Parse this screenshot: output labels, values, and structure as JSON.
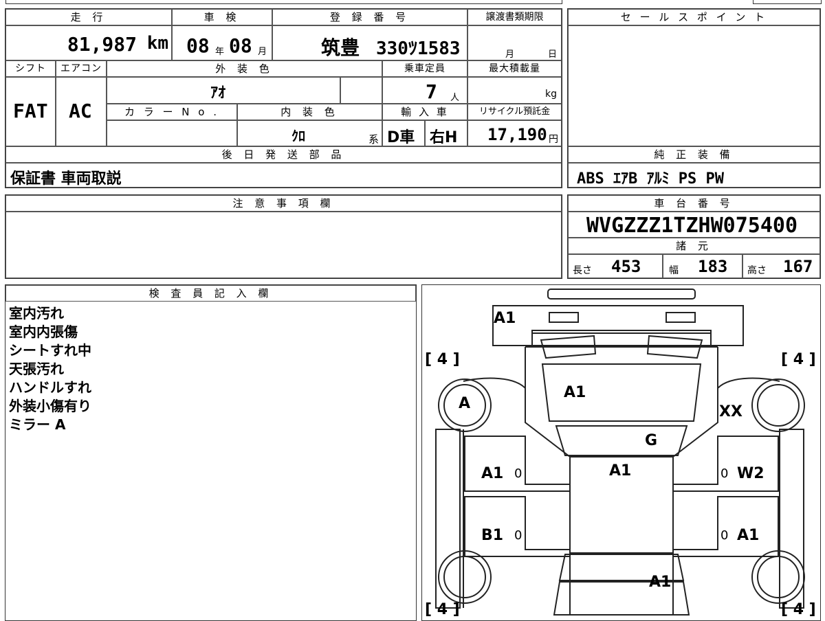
{
  "labels": {
    "mileage": "走 行",
    "inspection": "車 検",
    "registration": "登 録 番 号",
    "transfer_deadline": "譲渡書類期限",
    "sale_points": "セ ー ル ス ポ イ ン ト",
    "shift": "シフト",
    "aircon": "エアコン",
    "exterior_color": "外 装 色",
    "capacity": "乗車定員",
    "max_load": "最大積載量",
    "color_no": "カ ラ ー N o .",
    "interior_color": "内 装 色",
    "import": "輸 入 車",
    "recycle_fee": "リサイクル預託金",
    "later_parts": "後 日 発 送 部 品",
    "standard_equipment": "純 正 装 備",
    "notes": "注 意 事 項 欄",
    "chassis_number": "車 台 番 号",
    "specs": "諸 元",
    "inspector_notes": "検 査 員 記 入 欄"
  },
  "vehicle": {
    "mileage_value": "81,987",
    "mileage_unit": "km",
    "inspection_year": "08",
    "year_unit": "年",
    "inspection_month": "08",
    "month_unit": "月",
    "plate_region": "筑豊",
    "plate_number": "330ﾂ1583",
    "deadline_month": "月",
    "deadline_day": "日",
    "shift": "FAT",
    "aircon": "AC",
    "exterior_color": "ｱｵ",
    "capacity_value": "7",
    "capacity_unit": "人",
    "max_load_unit": "kg",
    "interior_color": "ｸﾛ",
    "interior_suffix": "系",
    "import_type": "D車",
    "handle": "右H",
    "recycle_value": "17,190",
    "recycle_unit": "円",
    "later_parts": "保証書 車両取説",
    "standard_equipment": "ABS ｴｱB ｱﾙﾐ PS PW",
    "chassis_number": "WVGZZZ1TZHW075400",
    "length_label": "長さ",
    "length_value": "453",
    "width_label": "幅",
    "width_value": "183",
    "height_label": "高さ",
    "height_value": "167"
  },
  "inspector_notes": [
    "室内汚れ",
    "室内内張傷",
    "シートすれ中",
    "天張汚れ",
    "ハンドルすれ",
    "外装小傷有り",
    "ミラー A"
  ],
  "diagram": {
    "tread_left_top": "[ 4 ]",
    "tread_right_top": "[ 4 ]",
    "tread_left_bottom": "[ 4 ]",
    "tread_right_bottom": "[ 4 ]",
    "mark_front": "A1",
    "mark_hood": "A1",
    "mark_wheel_fl": "A",
    "mark_fender_fr": "XX",
    "mark_glass": "G",
    "mark_roof": "A1",
    "mark_door_fl": "A1",
    "mark_door_fr": "W2",
    "mark_door_rl": "B1",
    "mark_door_rr": "A1",
    "mark_rear": "A1",
    "zero_fl": "0",
    "zero_fr": "0",
    "zero_rl": "0",
    "zero_rr": "0"
  }
}
